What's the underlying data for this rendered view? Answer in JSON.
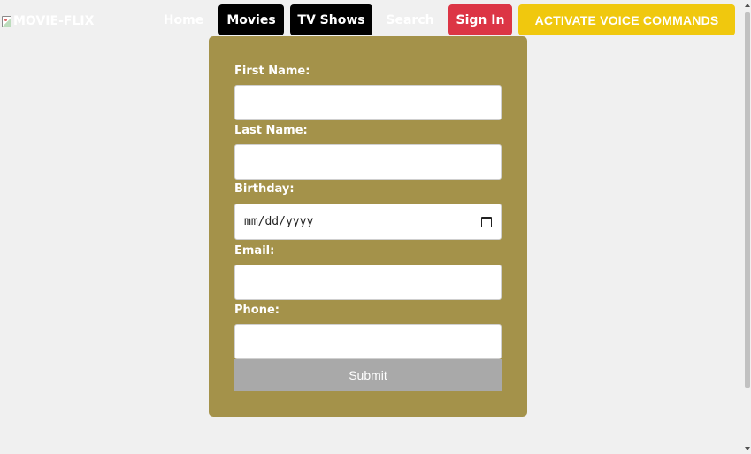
{
  "navbar": {
    "logo_alt": "MOVIE-FLIX",
    "home": "Home",
    "movies": "Movies",
    "tv_shows": "TV Shows",
    "search": "Search",
    "sign_in": "Sign In",
    "voice": "ACTIVATE VOICE COMMANDS"
  },
  "form": {
    "first_name_label": "First Name:",
    "first_name_value": "",
    "last_name_label": "Last Name:",
    "last_name_value": "",
    "birthday_label": "Birthday:",
    "birthday_placeholder": "mm/dd/yyyy",
    "email_label": "Email:",
    "email_value": "",
    "phone_label": "Phone:",
    "phone_value": "",
    "submit": "Submit"
  },
  "colors": {
    "form_background": "#a4924a",
    "voice_button": "#f0c80e",
    "sign_in_button": "#dc3545",
    "active_nav": "#000000",
    "submit_button": "#a9a9a9"
  }
}
